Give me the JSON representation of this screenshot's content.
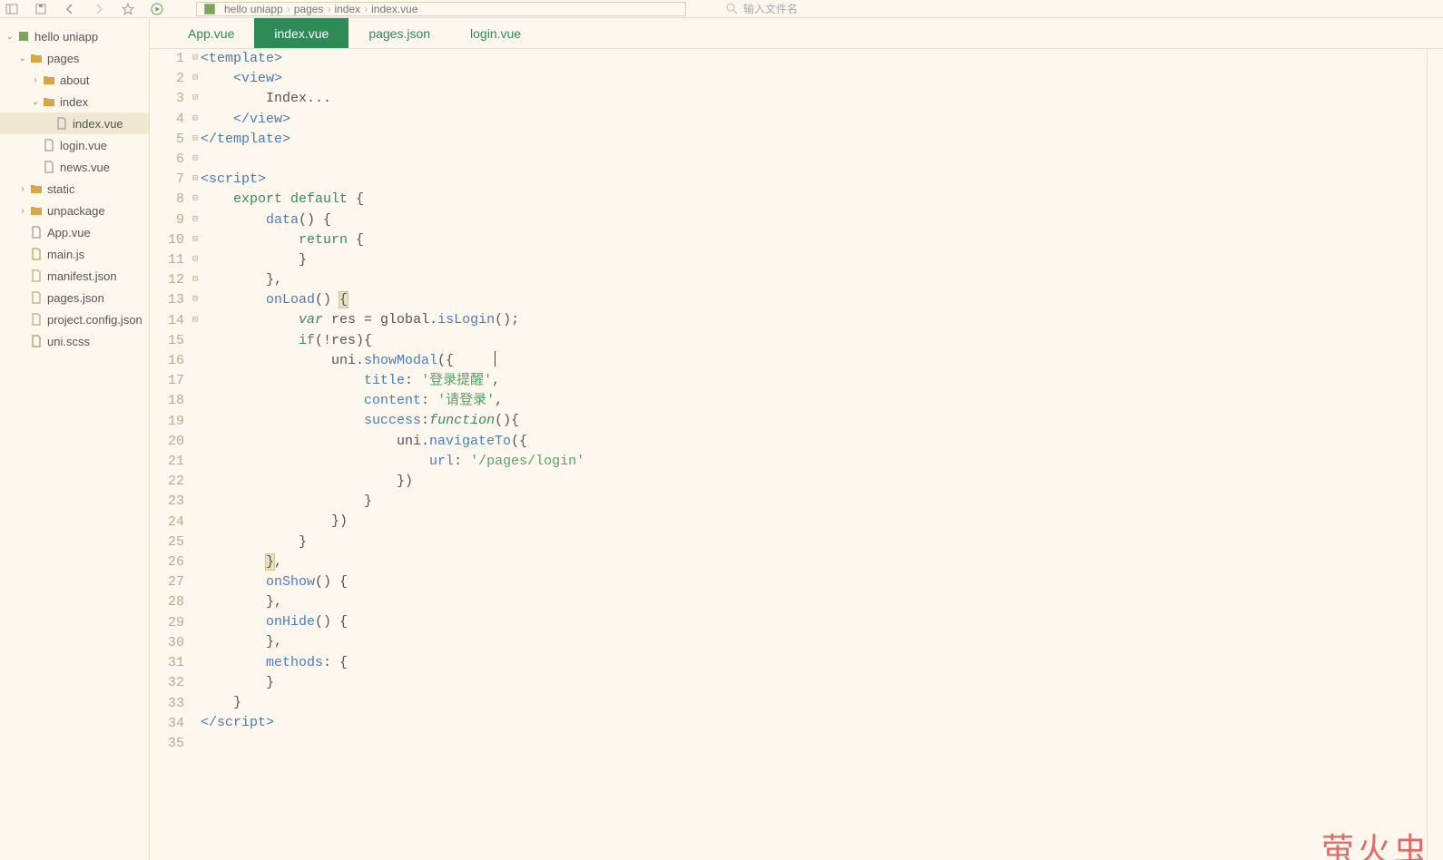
{
  "toolbar": {
    "search_placeholder": "输入文件名"
  },
  "breadcrumb": [
    "hello uniapp",
    "pages",
    "index",
    "index.vue"
  ],
  "tree": [
    {
      "indent": 0,
      "type": "folder",
      "arrow": "down",
      "label": "hello uniapp",
      "selected": false,
      "proj": true
    },
    {
      "indent": 1,
      "type": "folder",
      "arrow": "down",
      "label": "pages"
    },
    {
      "indent": 2,
      "type": "folder",
      "arrow": "right",
      "label": "about"
    },
    {
      "indent": 2,
      "type": "folder",
      "arrow": "down",
      "label": "index"
    },
    {
      "indent": 3,
      "type": "file",
      "file": "vue",
      "label": "index.vue",
      "selected": true
    },
    {
      "indent": 2,
      "type": "file",
      "file": "vue",
      "label": "login.vue"
    },
    {
      "indent": 2,
      "type": "file",
      "file": "vue",
      "label": "news.vue"
    },
    {
      "indent": 1,
      "type": "folder",
      "arrow": "right",
      "label": "static"
    },
    {
      "indent": 1,
      "type": "folder",
      "arrow": "right",
      "label": "unpackage"
    },
    {
      "indent": 1,
      "type": "file",
      "file": "vue",
      "label": "App.vue"
    },
    {
      "indent": 1,
      "type": "file",
      "file": "js",
      "label": "main.js"
    },
    {
      "indent": 1,
      "type": "file",
      "file": "json",
      "label": "manifest.json"
    },
    {
      "indent": 1,
      "type": "file",
      "file": "json",
      "label": "pages.json"
    },
    {
      "indent": 1,
      "type": "file",
      "file": "json",
      "label": "project.config.json"
    },
    {
      "indent": 1,
      "type": "file",
      "file": "css",
      "label": "uni.scss"
    }
  ],
  "tabs": [
    {
      "label": "App.vue",
      "active": false
    },
    {
      "label": "index.vue",
      "active": true
    },
    {
      "label": "pages.json",
      "active": false
    },
    {
      "label": "login.vue",
      "active": false
    }
  ],
  "code_strings": {
    "template_open": "<template>",
    "view_open": "<view>",
    "view_text": "Index...",
    "view_close": "</view>",
    "template_close": "</template>",
    "script_open": "<script>",
    "export": "export",
    "default": "default",
    "data": "data",
    "return": "return",
    "onLoad": "onLoad",
    "var": "var",
    "res": "res",
    "global": "global",
    "isLogin": "isLogin",
    "if": "if",
    "uni": "uni",
    "showModal": "showModal",
    "title": "title",
    "title_str": "'登录提醒'",
    "content": "content",
    "content_str": "'请登录'",
    "success": "success",
    "function": "function",
    "navigateTo": "navigateTo",
    "url": "url",
    "url_str": "'/pages/login'",
    "onShow": "onShow",
    "onHide": "onHide",
    "methods": "methods",
    "script_close": "</"
  },
  "fold_marks": {
    "1": "⊟",
    "2": "⊟",
    "7": "⊟",
    "8": "⊟",
    "9": "⊟",
    "10": "⊟",
    "13": "⊟",
    "15": "⊟",
    "16": "⊟",
    "19": "⊟",
    "20": "⊟",
    "27": "⊟",
    "29": "⊟",
    "31": "⊟"
  },
  "watermark": "萤火虫",
  "line_count": 35
}
